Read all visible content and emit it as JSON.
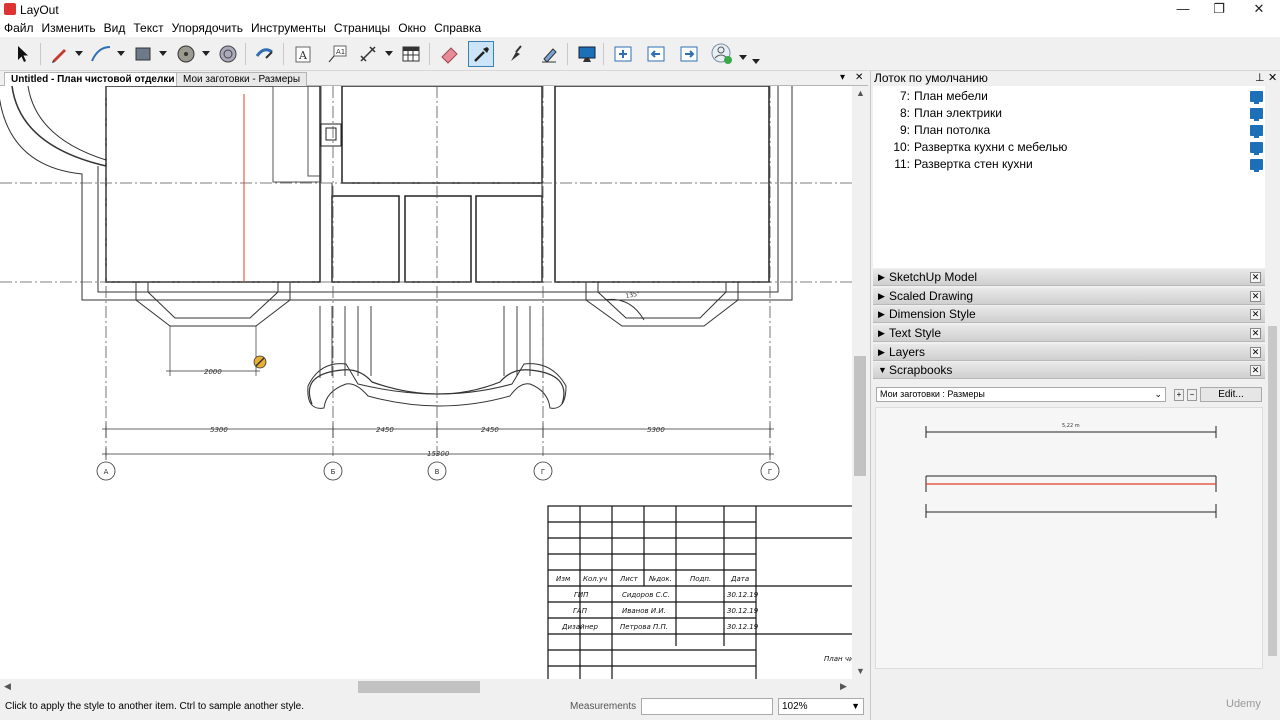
{
  "window": {
    "title": "LayOut",
    "controls": {
      "minimize": "—",
      "maximize": "❐",
      "close": "✕"
    }
  },
  "menubar": [
    "Файл",
    "Изменить",
    "Вид",
    "Текст",
    "Упорядочить",
    "Инструменты",
    "Страницы",
    "Окно",
    "Справка"
  ],
  "toolbar": {
    "tools": [
      "select-arrow-icon",
      "pencil-icon",
      "arc-icon",
      "rectangle-icon",
      "circle-icon",
      "offset-icon",
      "style-brush-icon",
      "text-icon",
      "label-icon",
      "dimension-icon",
      "table-icon",
      "eraser-icon",
      "style-sampler-icon",
      "split-icon",
      "join-icon",
      "presentation-icon",
      "add-page-icon",
      "previous-page-icon",
      "next-page-icon",
      "account-icon"
    ],
    "active_tool": "style-sampler-icon"
  },
  "tabs": [
    {
      "label": "Untitled - План чистовой отделки",
      "active": true
    },
    {
      "label": "Мои заготовки - Размеры",
      "active": false
    }
  ],
  "drawing": {
    "dim_small": "2000",
    "dim_row1": [
      "5300",
      "2450",
      "2450",
      "5300"
    ],
    "dim_total": "15300",
    "angle_label": "135°",
    "axes": [
      "А",
      "Б",
      "В",
      "Г",
      "Г"
    ],
    "title_block": {
      "headers": [
        "Изм",
        "Кол.уч",
        "Лист",
        "№док.",
        "Подп.",
        "Дата"
      ],
      "rows": [
        {
          "role": "ГИП",
          "name": "Сидоров С.С.",
          "date": "30.12.19"
        },
        {
          "role": "ГАП",
          "name": "Иванов И.И.",
          "date": "30.12.19"
        },
        {
          "role": "Дизайнер",
          "name": "Петрова П.П.",
          "date": "30.12.19"
        }
      ],
      "sheet_name": "План чи"
    }
  },
  "statusbar": {
    "hint": "Click to apply the style to another item. Ctrl to sample another style.",
    "measurements_label": "Measurements",
    "measurements_value": "",
    "zoom": "102%"
  },
  "tray": {
    "title": "Лоток по умолчанию",
    "pages": [
      {
        "num": "7:",
        "name": "План мебели"
      },
      {
        "num": "8:",
        "name": "План электрики"
      },
      {
        "num": "9:",
        "name": "План потолка"
      },
      {
        "num": "10:",
        "name": "Развертка кухни с мебелью"
      },
      {
        "num": "11:",
        "name": "Развертка стен кухни"
      }
    ],
    "sections": [
      {
        "name": "SketchUp Model",
        "expanded": false
      },
      {
        "name": "Scaled Drawing",
        "expanded": false
      },
      {
        "name": "Dimension Style",
        "expanded": false
      },
      {
        "name": "Text Style",
        "expanded": false
      },
      {
        "name": "Layers",
        "expanded": false
      },
      {
        "name": "Scrapbooks",
        "expanded": true
      }
    ],
    "scrapbook": {
      "selected": "Мои заготовки : Размеры",
      "edit_label": "Edit...",
      "sample_dim": "5,22 m"
    }
  },
  "watermark": "Udemy",
  "colors": {
    "accent": "#3c7fb1",
    "red_line": "#e0402a",
    "icon_blue": "#1d6fb8"
  }
}
